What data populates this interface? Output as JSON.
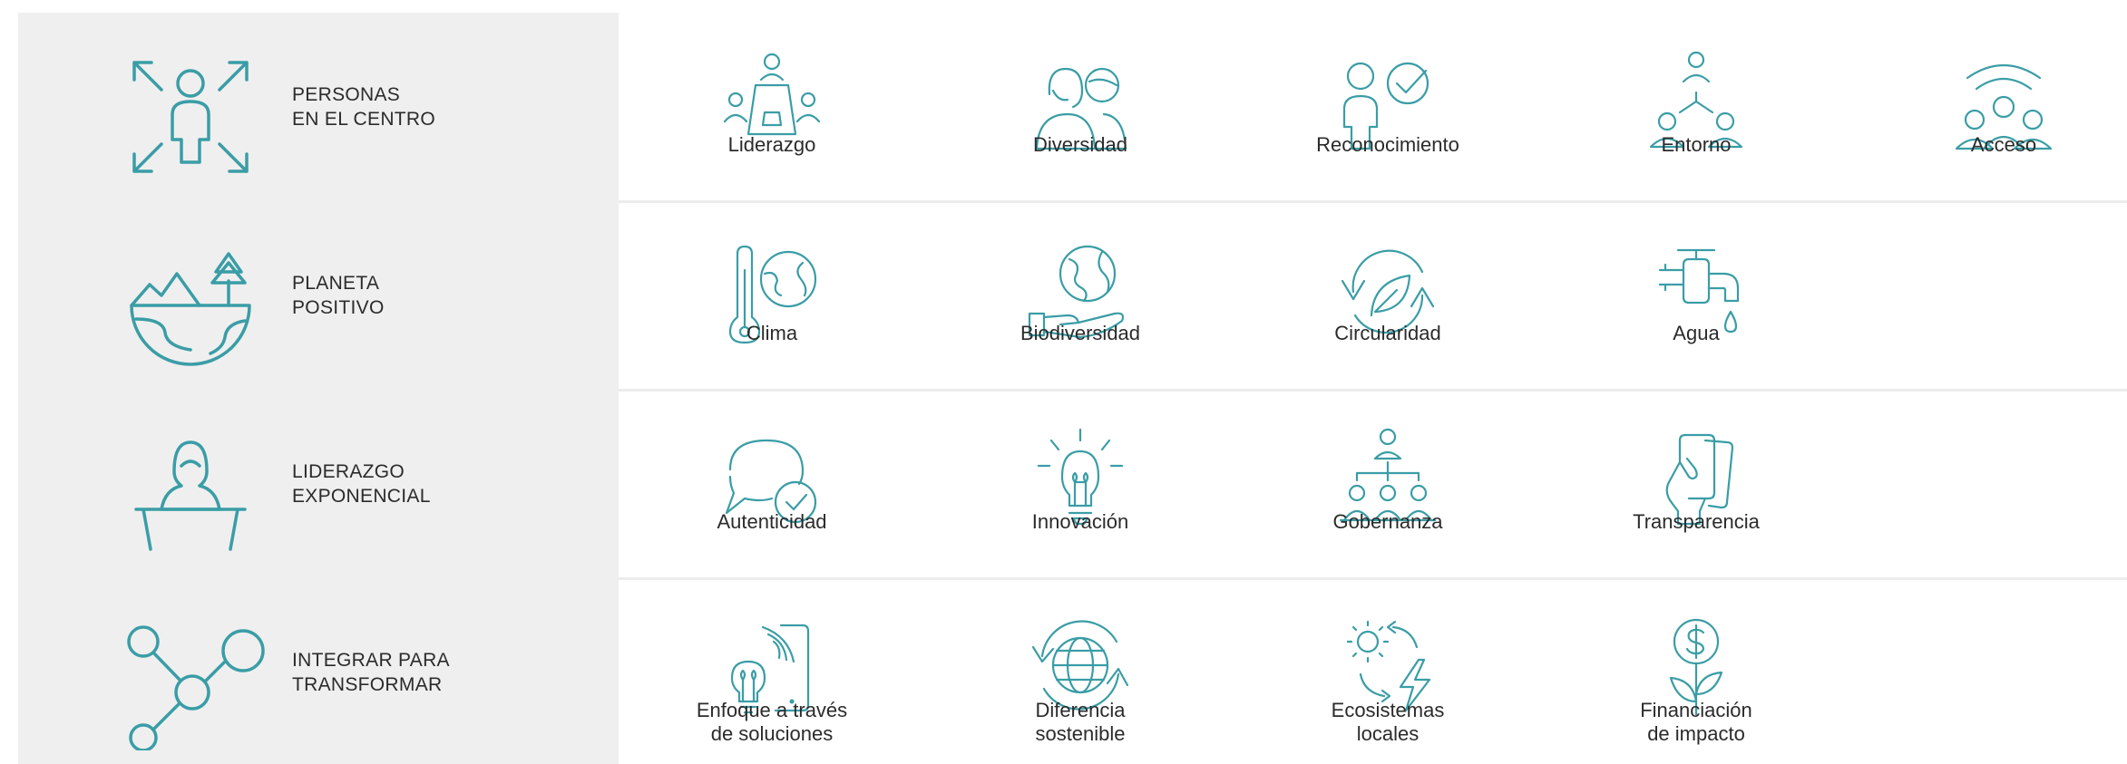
{
  "accent_color": "#3a9da6",
  "rows": [
    {
      "pillar": {
        "line1": "PERSONAS",
        "line2": "EN EL CENTRO",
        "icon": "person-center-arrows-icon"
      },
      "items": [
        {
          "label1": "Liderazgo",
          "label2": "",
          "icon": "leadership-group-icon"
        },
        {
          "label1": "Diversidad",
          "label2": "",
          "icon": "diversity-icon"
        },
        {
          "label1": "Reconocimiento",
          "label2": "",
          "icon": "recognition-icon"
        },
        {
          "label1": "Entorno",
          "label2": "",
          "icon": "environment-network-icon"
        },
        {
          "label1": "Acceso",
          "label2": "",
          "icon": "access-wifi-people-icon"
        }
      ]
    },
    {
      "pillar": {
        "line1": "PLANETA",
        "line2": "POSITIVO",
        "icon": "planet-positive-icon"
      },
      "items": [
        {
          "label1": "Clima",
          "label2": "",
          "icon": "climate-thermometer-icon"
        },
        {
          "label1": "Biodiversidad",
          "label2": "",
          "icon": "biodiversity-hand-globe-icon"
        },
        {
          "label1": "Circularidad",
          "label2": "",
          "icon": "circularity-leaf-icon"
        },
        {
          "label1": "Agua",
          "label2": "",
          "icon": "water-tap-icon"
        }
      ]
    },
    {
      "pillar": {
        "line1": "LIDERAZGO",
        "line2": "EXPONENCIAL",
        "icon": "exponential-leader-icon"
      },
      "items": [
        {
          "label1": "Autenticidad",
          "label2": "",
          "icon": "authenticity-speech-check-icon"
        },
        {
          "label1": "Innovación",
          "label2": "",
          "icon": "innovation-lightbulb-icon"
        },
        {
          "label1": "Gobernanza",
          "label2": "",
          "icon": "governance-org-chart-icon"
        },
        {
          "label1": "Transparencia",
          "label2": "",
          "icon": "transparency-hand-card-icon"
        }
      ]
    },
    {
      "pillar": {
        "line1": "INTEGRAR PARA",
        "line2": "TRANSFORMAR",
        "icon": "integrate-nodes-icon"
      },
      "items": [
        {
          "label1": "Enfoque a través",
          "label2": "de soluciones",
          "icon": "solutions-phone-bulb-icon"
        },
        {
          "label1": "Diferencia",
          "label2": "sostenible",
          "icon": "sustainable-globe-icon"
        },
        {
          "label1": "Ecosistemas",
          "label2": "locales",
          "icon": "local-ecosystems-icon"
        },
        {
          "label1": "Financiación",
          "label2": "de impacto",
          "icon": "impact-finance-plant-icon"
        }
      ]
    }
  ]
}
